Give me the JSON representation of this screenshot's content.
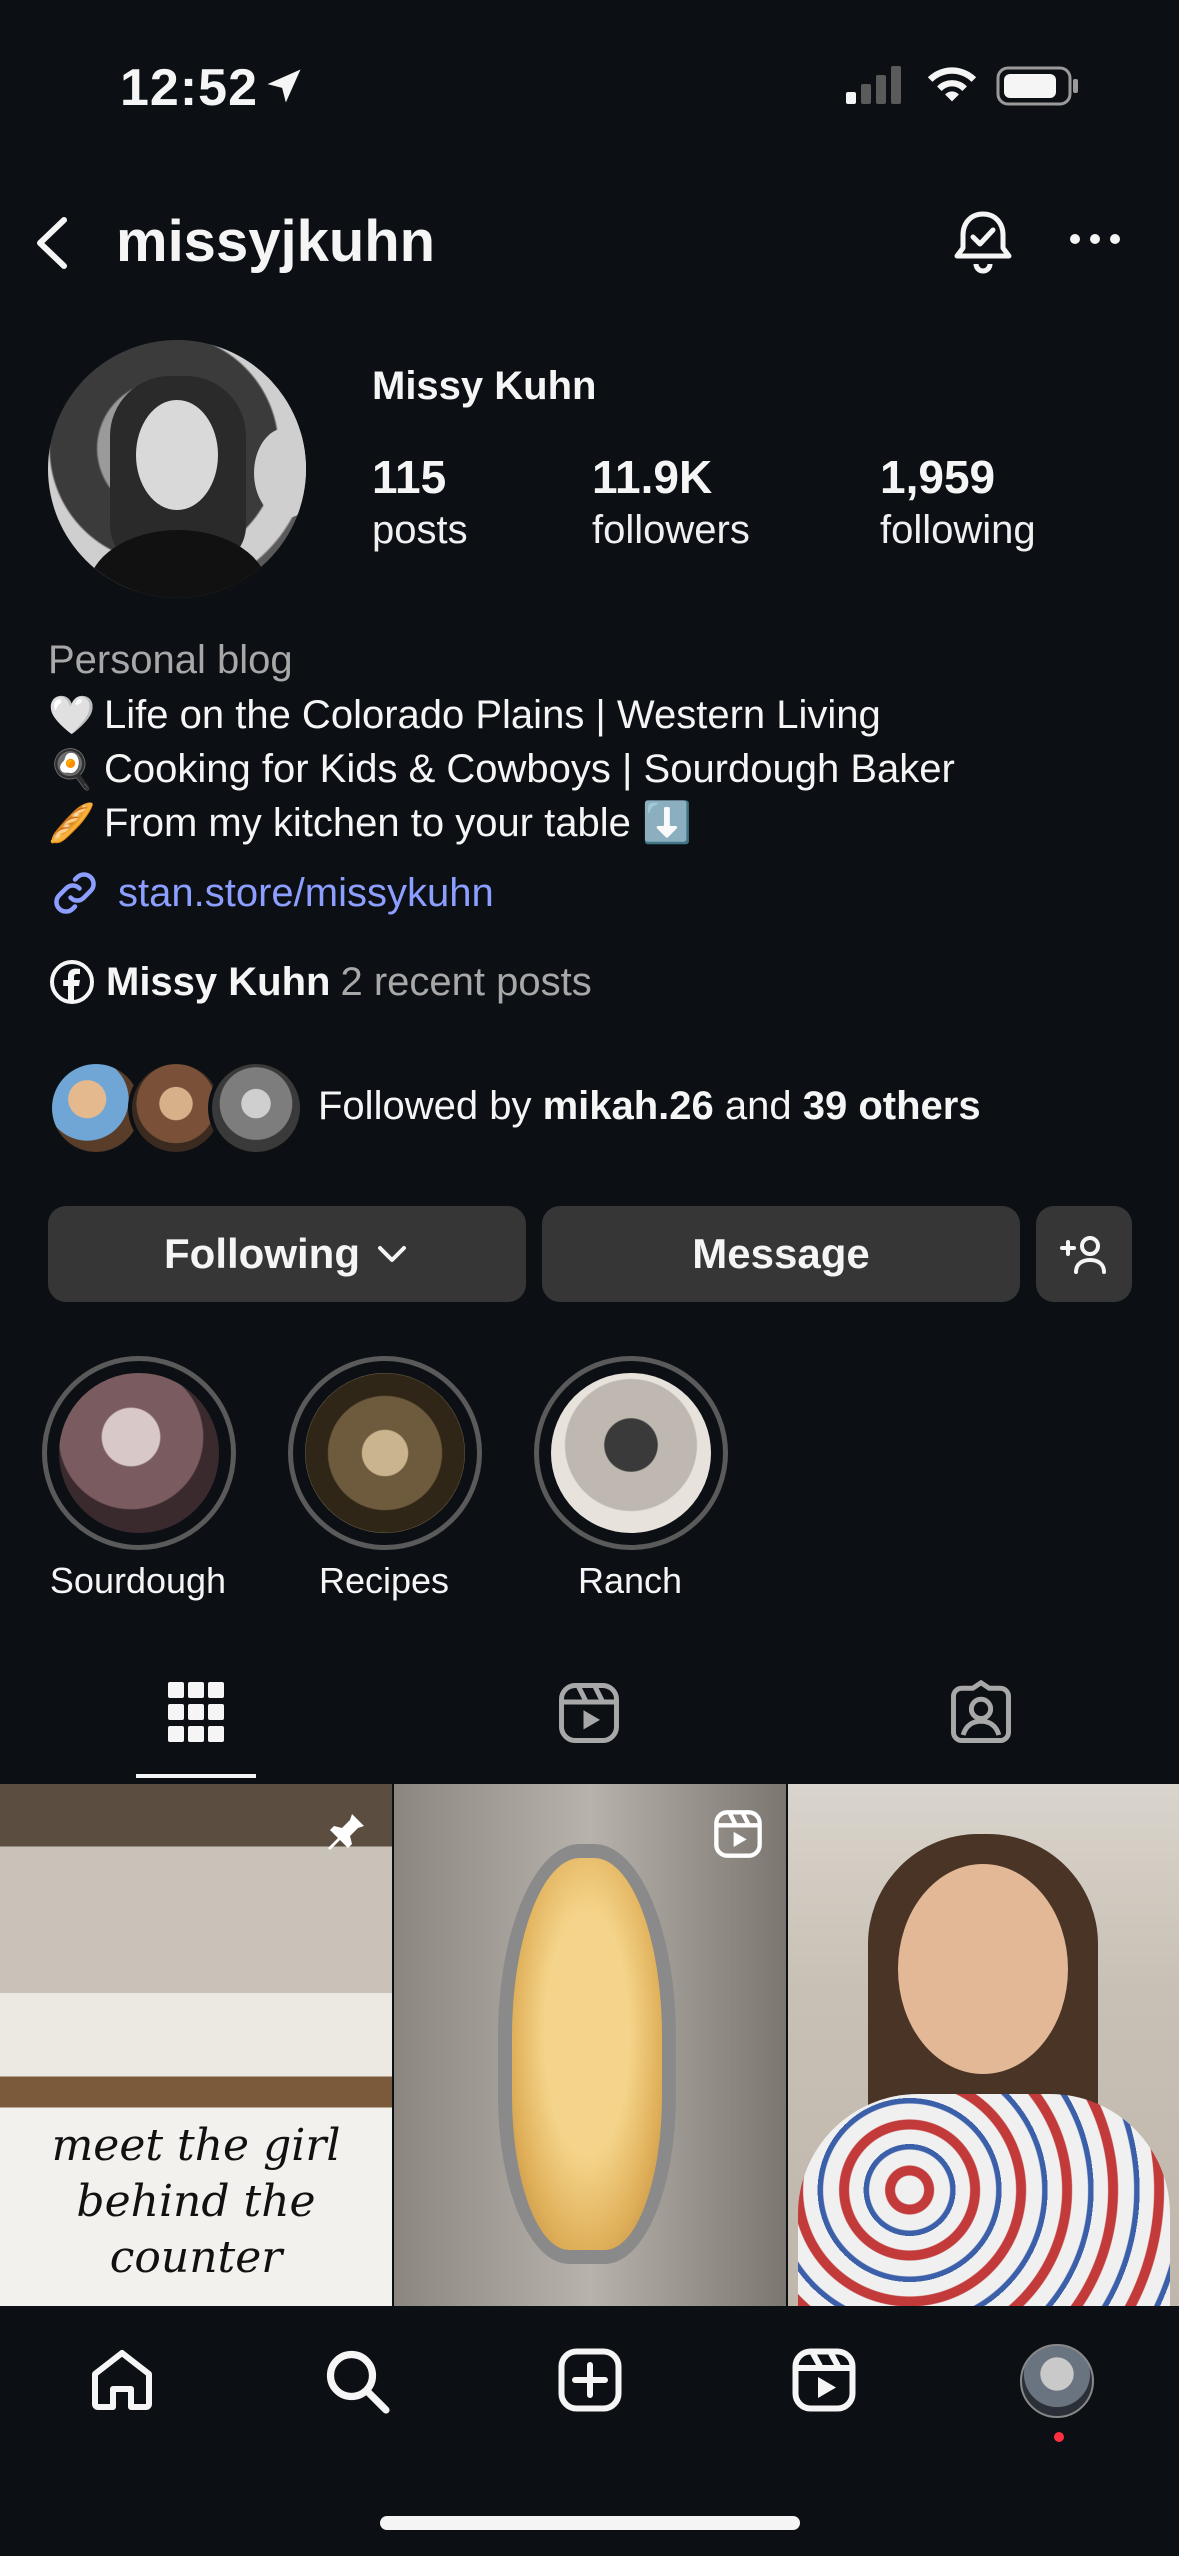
{
  "status_bar": {
    "time": "12:52"
  },
  "header": {
    "username": "missyjkuhn"
  },
  "profile": {
    "full_name": "Missy Kuhn",
    "stats": [
      {
        "value": "115",
        "label": "posts"
      },
      {
        "value": "11.9K",
        "label": "followers"
      },
      {
        "value": "1,959",
        "label": "following"
      }
    ],
    "category": "Personal blog",
    "bio_lines": [
      {
        "emoji": "🤍",
        "text": "Life on the Colorado Plains | Western Living"
      },
      {
        "emoji": "🍳",
        "text": "Cooking for Kids & Cowboys | Sourdough Baker"
      },
      {
        "emoji": "🥖",
        "text": "From my kitchen to your table ⬇️"
      }
    ],
    "link": "stan.store/missykuhn",
    "facebook": {
      "name": "Missy Kuhn",
      "suffix": "2 recent posts"
    },
    "followed_by": {
      "prefix": "Followed by ",
      "user": "mikah.26",
      "and": " and ",
      "others": "39 others"
    }
  },
  "buttons": {
    "following": "Following",
    "message": "Message"
  },
  "highlights": [
    {
      "label": "Sourdough"
    },
    {
      "label": "Recipes"
    },
    {
      "label": "Ranch"
    }
  ],
  "grid": {
    "tile1_text": "meet the girl behind the counter"
  },
  "icons": [
    "back-icon",
    "bell-icon",
    "more-icon",
    "link-icon",
    "facebook-icon",
    "chevron-down-icon",
    "add-person-icon",
    "grid-icon",
    "reels-icon",
    "tagged-icon",
    "pin-icon",
    "home-icon",
    "search-icon",
    "create-icon"
  ],
  "colors": {
    "background": "#0c1014",
    "button": "#363636",
    "link": "#8c9eff",
    "notification_dot": "#ff3040"
  }
}
